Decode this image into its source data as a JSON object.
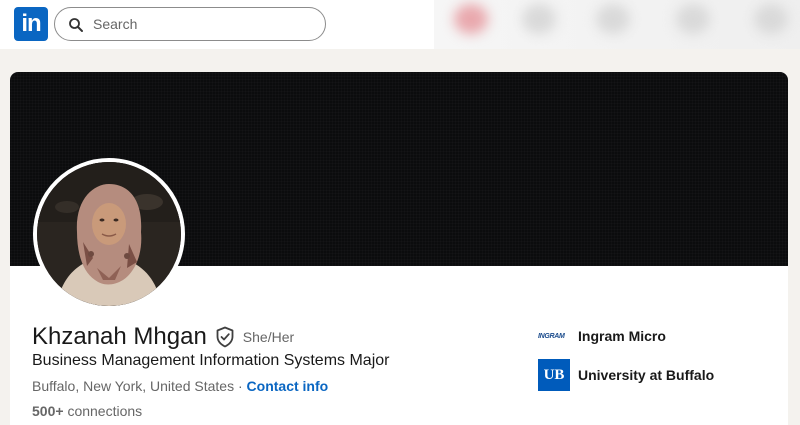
{
  "nav": {
    "logo_text": "in",
    "search": {
      "placeholder": "Search"
    }
  },
  "profile": {
    "name": "Khzanah Mhgan",
    "pronouns": "She/Her",
    "headline": "Business Management Information Systems Major",
    "location": "Buffalo, New York, United States",
    "separator": "·",
    "contact_label": "Contact info",
    "connections_count": "500+",
    "connections_label": "connections"
  },
  "orgs": [
    {
      "name": "Ingram Micro",
      "logo_text": "INGRAM"
    },
    {
      "name": "University at Buffalo",
      "logo_text": "UB"
    }
  ],
  "colors": {
    "brand": "#0a66c2",
    "cover": "#0b0c0d",
    "page_bg": "#f4f2ee",
    "ub_blue": "#005bbb"
  }
}
